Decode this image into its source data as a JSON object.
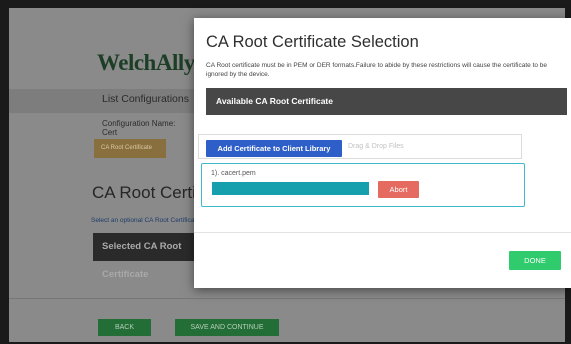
{
  "background": {
    "logo_text": "WelchAllyn",
    "nav_link": "List Configurations",
    "configuration_label": "Configuration Name:",
    "configuration_value": "Cert",
    "cert_chip": "CA Root Certificate",
    "heading": "CA Root Certificate",
    "hint": "Select an optional CA Root Certificate",
    "selected_bar": "Selected CA Root Certificate",
    "back_label": "BACK",
    "save_label": "SAVE AND CONTINUE"
  },
  "modal": {
    "title": "CA Root Certificate Selection",
    "description": "CA Root certificate must be in PEM or DER formats.Failure to abide by these restrictions will cause the certificate to be ignored by the device.",
    "available_header": "Available CA Root Certificate",
    "add_button": "Add Certificate to Client Library",
    "drop_hint": "Drag & Drop Files",
    "file": {
      "name": "1). cacert.pem",
      "progress": 1.0,
      "abort_label": "Abort"
    },
    "done_label": "DONE"
  },
  "colors": {
    "accent_blue": "#2e5ec8",
    "progress_teal": "#16a0ad",
    "abort_red": "#e56a60",
    "done_green": "#2fcb6c",
    "file_border": "#40b9cf"
  }
}
